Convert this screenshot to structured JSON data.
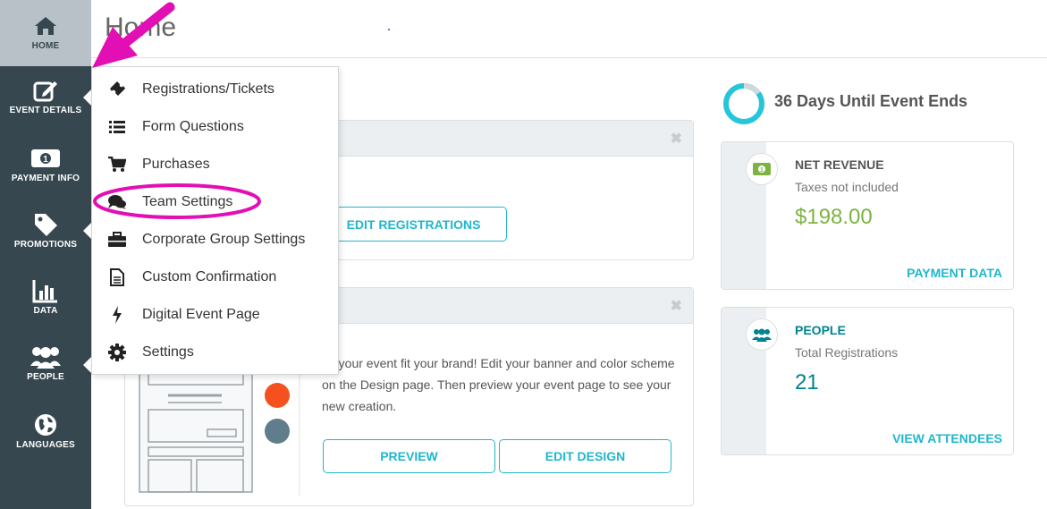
{
  "page": {
    "title": "Home"
  },
  "sidebar": {
    "items": [
      {
        "label": "HOME",
        "icon": "home-icon"
      },
      {
        "label": "EVENT DETAILS",
        "icon": "edit-icon"
      },
      {
        "label": "PAYMENT INFO",
        "icon": "money-icon"
      },
      {
        "label": "PROMOTIONS",
        "icon": "tag-icon"
      },
      {
        "label": "DATA",
        "icon": "bar-chart-icon"
      },
      {
        "label": "PEOPLE",
        "icon": "users-icon"
      },
      {
        "label": "LANGUAGES",
        "icon": "globe-icon"
      }
    ]
  },
  "menu": {
    "items": [
      {
        "label": "Registrations/Tickets",
        "icon": "ticket-icon"
      },
      {
        "label": "Form Questions",
        "icon": "list-icon"
      },
      {
        "label": "Purchases",
        "icon": "cart-icon"
      },
      {
        "label": "Team Settings",
        "icon": "comments-icon"
      },
      {
        "label": "Corporate Group Settings",
        "icon": "briefcase-icon"
      },
      {
        "label": "Custom Confirmation",
        "icon": "document-icon"
      },
      {
        "label": "Digital Event Page",
        "icon": "bolt-icon"
      },
      {
        "label": "Settings",
        "icon": "gear-icon"
      }
    ]
  },
  "registrations_card": {
    "button": "EDIT REGISTRATIONS"
  },
  "design_card": {
    "text_visible": "ke your event fit your brand! Edit your banner and color scheme on the Design page. Then preview your event page to see your new creation.",
    "preview_button": "PREVIEW",
    "edit_button": "EDIT DESIGN",
    "swatches": [
      "#f4511e",
      "#607d8b"
    ]
  },
  "countdown": {
    "text": "36 Days Until Event Ends",
    "progress_fraction": 0.15
  },
  "revenue": {
    "title": "NET REVENUE",
    "subtitle": "Taxes not included",
    "value": "$198.00",
    "link": "PAYMENT DATA",
    "value_color": "#7cb342"
  },
  "people": {
    "title": "PEOPLE",
    "subtitle": "Total Registrations",
    "value": "21",
    "link": "VIEW ATTENDEES",
    "value_color": "#00838f"
  },
  "colors": {
    "sidebar": "#37474f",
    "accent": "#1fb7cc",
    "annotation": "#e20fb4"
  }
}
